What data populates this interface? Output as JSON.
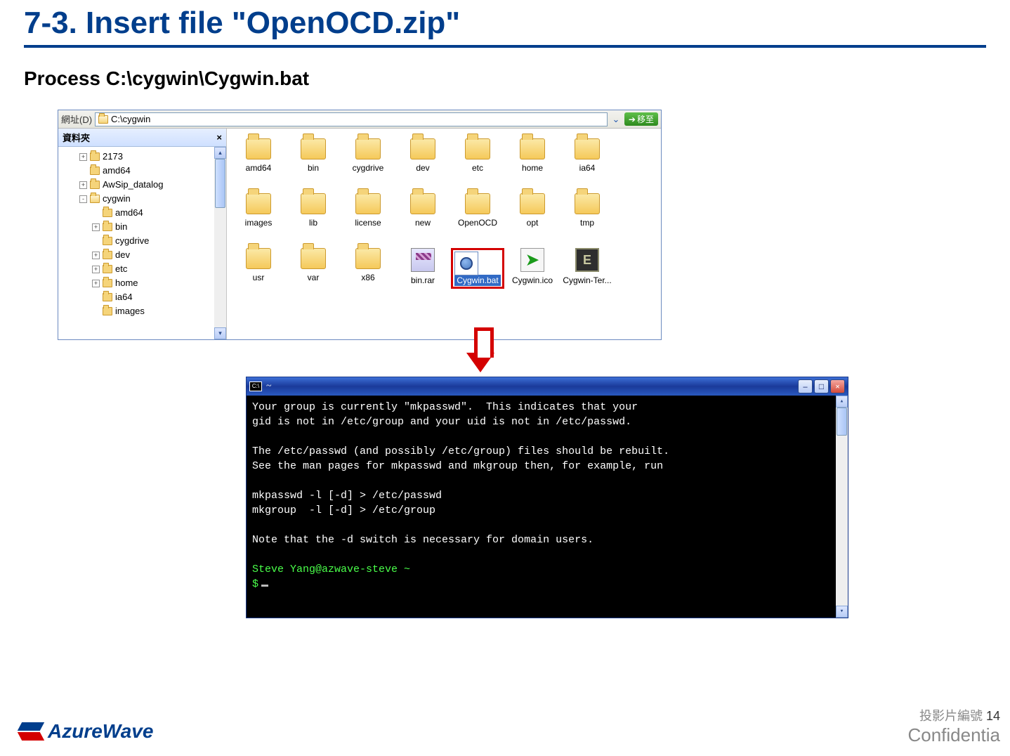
{
  "title": "7-3. Insert file \"OpenOCD.zip\"",
  "subtitle": "Process C:\\cygwin\\Cygwin.bat",
  "explorer": {
    "addr_label": "網址(D)",
    "addr_path": "C:\\cygwin",
    "go_label": "移至",
    "tree_header": "資料夾",
    "tree": {
      "n0": {
        "label": "2173",
        "expander": "+"
      },
      "n1": {
        "label": "amd64",
        "expander": ""
      },
      "n2": {
        "label": "AwSip_datalog",
        "expander": "+"
      },
      "n3": {
        "label": "cygwin",
        "expander": "-"
      },
      "n4": {
        "label": "amd64",
        "expander": ""
      },
      "n5": {
        "label": "bin",
        "expander": "+"
      },
      "n6": {
        "label": "cygdrive",
        "expander": ""
      },
      "n7": {
        "label": "dev",
        "expander": "+"
      },
      "n8": {
        "label": "etc",
        "expander": "+"
      },
      "n9": {
        "label": "home",
        "expander": "+"
      },
      "n10": {
        "label": "ia64",
        "expander": ""
      },
      "n11": {
        "label": "images",
        "expander": ""
      }
    },
    "files": {
      "f0": {
        "label": "amd64",
        "type": "folder"
      },
      "f1": {
        "label": "bin",
        "type": "folder"
      },
      "f2": {
        "label": "cygdrive",
        "type": "folder"
      },
      "f3": {
        "label": "dev",
        "type": "folder"
      },
      "f4": {
        "label": "etc",
        "type": "folder"
      },
      "f5": {
        "label": "home",
        "type": "folder"
      },
      "f6": {
        "label": "ia64",
        "type": "folder"
      },
      "f7": {
        "label": "images",
        "type": "folder"
      },
      "f8": {
        "label": "lib",
        "type": "folder"
      },
      "f9": {
        "label": "license",
        "type": "folder"
      },
      "f10": {
        "label": "new",
        "type": "folder"
      },
      "f11": {
        "label": "OpenOCD",
        "type": "folder"
      },
      "f12": {
        "label": "opt",
        "type": "folder"
      },
      "f13": {
        "label": "tmp",
        "type": "folder"
      },
      "f14": {
        "label": "usr",
        "type": "folder"
      },
      "f15": {
        "label": "var",
        "type": "folder"
      },
      "f16": {
        "label": "x86",
        "type": "folder"
      },
      "f17": {
        "label": "bin.rar",
        "type": "rar"
      },
      "f18": {
        "label": "Cygwin.bat",
        "type": "bat",
        "selected": true
      },
      "f19": {
        "label": "Cygwin.ico",
        "type": "ico"
      },
      "f20": {
        "label": "Cygwin-Ter...",
        "type": "ter"
      }
    }
  },
  "console": {
    "title": "~",
    "icon_txt": "C:\\",
    "line1": "Your group is currently \"mkpasswd\".  This indicates that your",
    "line2": "gid is not in /etc/group and your uid is not in /etc/passwd.",
    "line3": "The /etc/passwd (and possibly /etc/group) files should be rebuilt.",
    "line4": "See the man pages for mkpasswd and mkgroup then, for example, run",
    "line5": "mkpasswd -l [-d] > /etc/passwd",
    "line6": "mkgroup  -l [-d] > /etc/group",
    "line7": "Note that the -d switch is necessary for domain users.",
    "prompt_user": "Steve Yang@azwave-steve ~",
    "prompt_sym": "$"
  },
  "footer": {
    "brand": "AzureWave",
    "slide_label": "投影片編號 ",
    "slide_num": "14",
    "confidential": "Confidentia"
  }
}
